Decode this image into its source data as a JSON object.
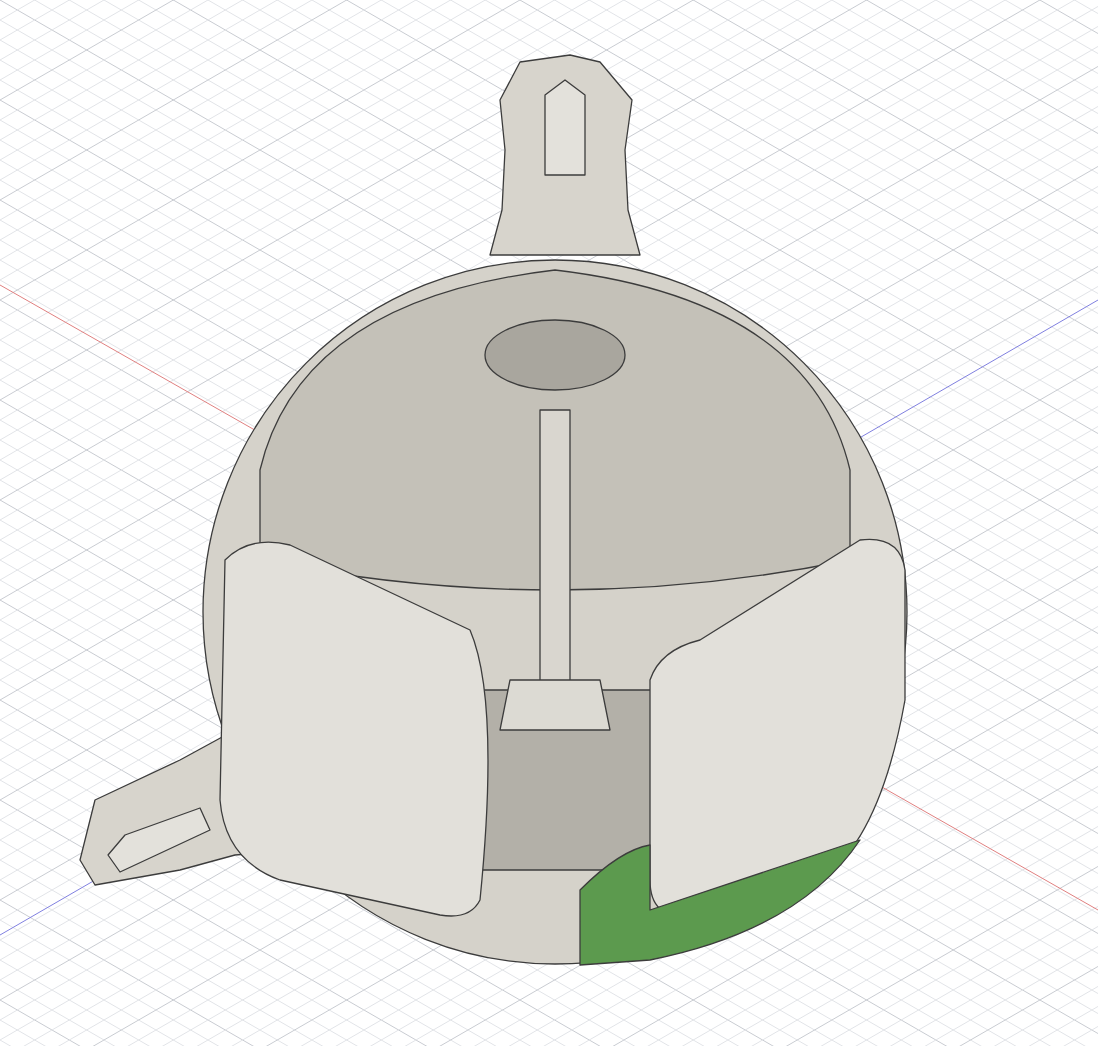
{
  "viewport": {
    "grid": {
      "visible": true
    },
    "axes": [
      {
        "color": "#e08080"
      },
      {
        "color": "#8080e0"
      }
    ],
    "model": {
      "highlighted_face": true
    }
  }
}
